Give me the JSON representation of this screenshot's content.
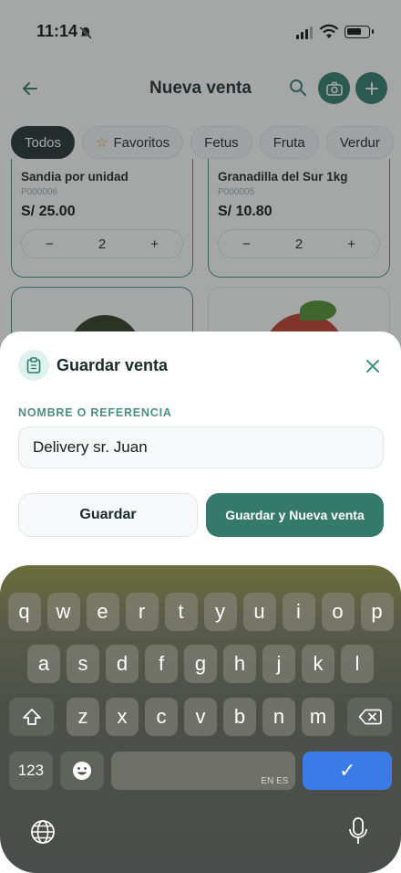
{
  "status": {
    "time": "11:14"
  },
  "header": {
    "title": "Nueva venta"
  },
  "filters": [
    {
      "label": "Todos",
      "active": true
    },
    {
      "label": "Favoritos",
      "active": false,
      "icon": "star-icon"
    },
    {
      "label": "Fetus",
      "active": false
    },
    {
      "label": "Fruta",
      "active": false
    },
    {
      "label": "Verdur",
      "active": false
    }
  ],
  "products": [
    {
      "name": "Sandia por unidad",
      "code": "P000006",
      "price": "S/ 25.00",
      "qty": "2"
    },
    {
      "name": "Granadilla del Sur 1kg",
      "code": "P000005",
      "price": "S/ 10.80",
      "qty": "2"
    }
  ],
  "stepper": {
    "minus": "−",
    "plus": "+"
  },
  "sheet": {
    "title": "Guardar venta",
    "field_label": "NOMBRE O REFERENCIA",
    "ref_value": "Delivery sr. Juan",
    "save_label": "Guardar",
    "save_new_label": "Guardar y Nueva venta"
  },
  "keyboard": {
    "row1": [
      "q",
      "w",
      "e",
      "r",
      "t",
      "y",
      "u",
      "i",
      "o",
      "p"
    ],
    "row2": [
      "a",
      "s",
      "d",
      "f",
      "g",
      "h",
      "j",
      "k",
      "l"
    ],
    "row3": [
      "z",
      "x",
      "c",
      "v",
      "b",
      "n",
      "m"
    ],
    "numbers_label": "123",
    "language_hint": "EN ES",
    "done_label": "✓"
  },
  "colors": {
    "accent": "#35796a",
    "dark": "#1f2d2b",
    "done": "#3a7be8"
  }
}
